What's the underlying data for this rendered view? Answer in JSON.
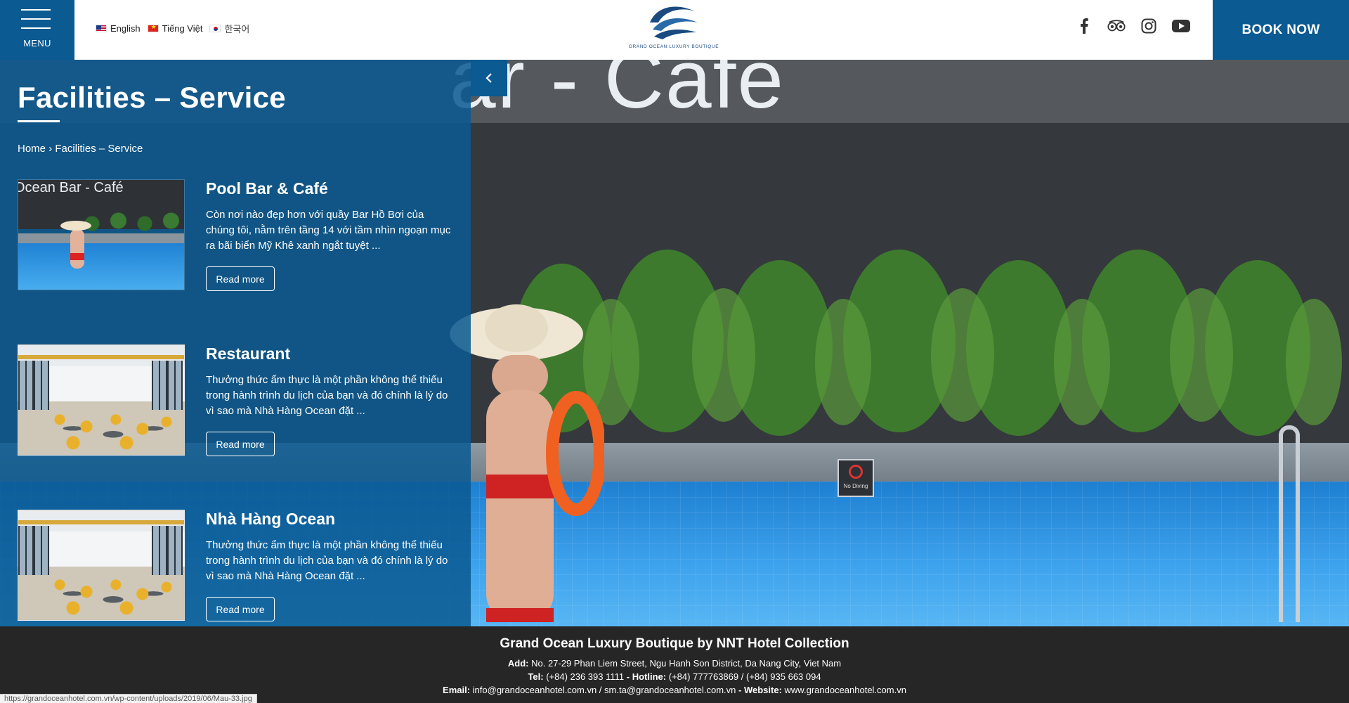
{
  "header": {
    "menu_label": "MENU",
    "languages": [
      {
        "label": "English",
        "flag": "us-flag-icon"
      },
      {
        "label": "Tiếng Việt",
        "flag": "vn-flag-icon"
      },
      {
        "label": "한국어",
        "flag": "kr-flag-icon"
      }
    ],
    "logo_text": "GRAND OCEAN LUXURY BOUTIQUE",
    "socials": [
      "facebook-icon",
      "tripadvisor-icon",
      "instagram-icon",
      "youtube-icon"
    ],
    "book_label": "BOOK NOW",
    "brand_color": "#0b5a92"
  },
  "page": {
    "title": "Facilities – Service",
    "breadcrumb": {
      "home": "Home",
      "separator": "›",
      "current": "Facilities – Service"
    }
  },
  "hero": {
    "sign_text": "ar - Cafe",
    "no_diving": "No Diving"
  },
  "items": [
    {
      "title": "Pool Bar & Café",
      "description": "Còn nơi nào đẹp hơn với quầy Bar Hồ Bơi của chúng tôi, nằm trên tầng 14 với tầm nhìn ngoạn mục ra bãi biển Mỹ Khê xanh ngắt tuyệt ...",
      "read_more": "Read more",
      "thumb_sign": "Ocean Bar - Café"
    },
    {
      "title": "Restaurant",
      "description": "Thưởng thức ẩm thực là một phần không thể thiếu trong hành trình du lịch của bạn và đó chính là lý do vì sao mà Nhà Hàng Ocean đặt ...",
      "read_more": "Read more"
    },
    {
      "title": "Nhà Hàng Ocean",
      "description": "Thưởng thức ẩm thực là một phần không thể thiếu trong hành trình du lịch của bạn và đó chính là lý do vì sao mà Nhà Hàng Ocean đặt ...",
      "read_more": "Read more"
    }
  ],
  "footer": {
    "name": "Grand Ocean Luxury Boutique by NNT Hotel Collection",
    "add_label": "Add:",
    "address": "No. 27-29 Phan Liem Street, Ngu Hanh Son District, Da Nang City, Viet Nam",
    "tel_label": "Tel:",
    "tel": "(+84) 236 393 1111",
    "hotline_label": "Hotline:",
    "hotline": "(+84) 777763869 / (+84) 935 663 094",
    "email_label": "Email:",
    "email": "info@grandoceanhotel.com.vn / sm.ta@grandoceanhotel.com.vn",
    "website_label": "Website:",
    "website": "www.grandoceanhotel.com.vn"
  },
  "status_bar": {
    "url": "https://grandoceanhotel.com.vn/wp-content/uploads/2019/06/Mau-33.jpg"
  }
}
